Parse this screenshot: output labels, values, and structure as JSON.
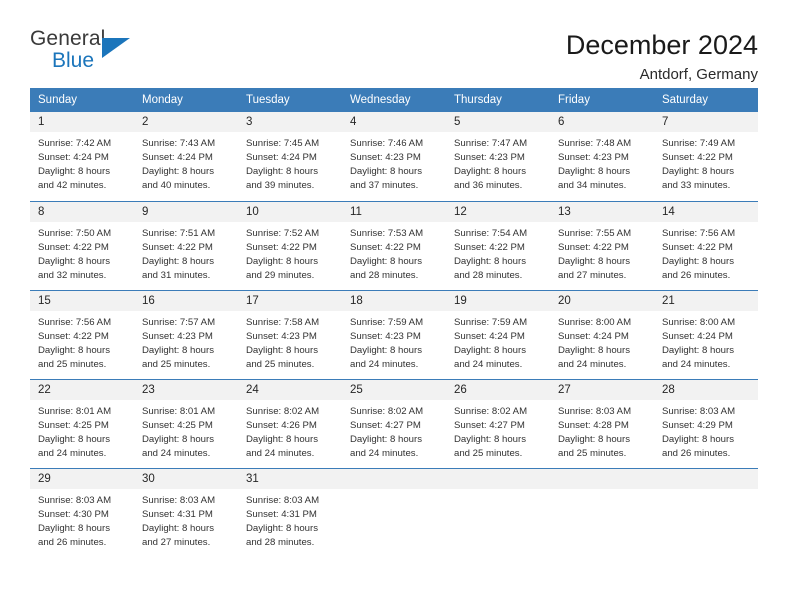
{
  "brand": {
    "name_part1": "General",
    "name_part2": "Blue",
    "accent_color": "#1b75bb",
    "triangle_icon": "triangle-icon"
  },
  "header": {
    "title": "December 2024",
    "subtitle": "Antdorf, Germany"
  },
  "calendar": {
    "header_bg": "#3b7cb8",
    "daynum_bg": "#f2f2f2",
    "weekdays": [
      "Sunday",
      "Monday",
      "Tuesday",
      "Wednesday",
      "Thursday",
      "Friday",
      "Saturday"
    ],
    "weeks": [
      [
        {
          "day": "1",
          "sunrise": "Sunrise: 7:42 AM",
          "sunset": "Sunset: 4:24 PM",
          "daylight1": "Daylight: 8 hours",
          "daylight2": "and 42 minutes."
        },
        {
          "day": "2",
          "sunrise": "Sunrise: 7:43 AM",
          "sunset": "Sunset: 4:24 PM",
          "daylight1": "Daylight: 8 hours",
          "daylight2": "and 40 minutes."
        },
        {
          "day": "3",
          "sunrise": "Sunrise: 7:45 AM",
          "sunset": "Sunset: 4:24 PM",
          "daylight1": "Daylight: 8 hours",
          "daylight2": "and 39 minutes."
        },
        {
          "day": "4",
          "sunrise": "Sunrise: 7:46 AM",
          "sunset": "Sunset: 4:23 PM",
          "daylight1": "Daylight: 8 hours",
          "daylight2": "and 37 minutes."
        },
        {
          "day": "5",
          "sunrise": "Sunrise: 7:47 AM",
          "sunset": "Sunset: 4:23 PM",
          "daylight1": "Daylight: 8 hours",
          "daylight2": "and 36 minutes."
        },
        {
          "day": "6",
          "sunrise": "Sunrise: 7:48 AM",
          "sunset": "Sunset: 4:23 PM",
          "daylight1": "Daylight: 8 hours",
          "daylight2": "and 34 minutes."
        },
        {
          "day": "7",
          "sunrise": "Sunrise: 7:49 AM",
          "sunset": "Sunset: 4:22 PM",
          "daylight1": "Daylight: 8 hours",
          "daylight2": "and 33 minutes."
        }
      ],
      [
        {
          "day": "8",
          "sunrise": "Sunrise: 7:50 AM",
          "sunset": "Sunset: 4:22 PM",
          "daylight1": "Daylight: 8 hours",
          "daylight2": "and 32 minutes."
        },
        {
          "day": "9",
          "sunrise": "Sunrise: 7:51 AM",
          "sunset": "Sunset: 4:22 PM",
          "daylight1": "Daylight: 8 hours",
          "daylight2": "and 31 minutes."
        },
        {
          "day": "10",
          "sunrise": "Sunrise: 7:52 AM",
          "sunset": "Sunset: 4:22 PM",
          "daylight1": "Daylight: 8 hours",
          "daylight2": "and 29 minutes."
        },
        {
          "day": "11",
          "sunrise": "Sunrise: 7:53 AM",
          "sunset": "Sunset: 4:22 PM",
          "daylight1": "Daylight: 8 hours",
          "daylight2": "and 28 minutes."
        },
        {
          "day": "12",
          "sunrise": "Sunrise: 7:54 AM",
          "sunset": "Sunset: 4:22 PM",
          "daylight1": "Daylight: 8 hours",
          "daylight2": "and 28 minutes."
        },
        {
          "day": "13",
          "sunrise": "Sunrise: 7:55 AM",
          "sunset": "Sunset: 4:22 PM",
          "daylight1": "Daylight: 8 hours",
          "daylight2": "and 27 minutes."
        },
        {
          "day": "14",
          "sunrise": "Sunrise: 7:56 AM",
          "sunset": "Sunset: 4:22 PM",
          "daylight1": "Daylight: 8 hours",
          "daylight2": "and 26 minutes."
        }
      ],
      [
        {
          "day": "15",
          "sunrise": "Sunrise: 7:56 AM",
          "sunset": "Sunset: 4:22 PM",
          "daylight1": "Daylight: 8 hours",
          "daylight2": "and 25 minutes."
        },
        {
          "day": "16",
          "sunrise": "Sunrise: 7:57 AM",
          "sunset": "Sunset: 4:23 PM",
          "daylight1": "Daylight: 8 hours",
          "daylight2": "and 25 minutes."
        },
        {
          "day": "17",
          "sunrise": "Sunrise: 7:58 AM",
          "sunset": "Sunset: 4:23 PM",
          "daylight1": "Daylight: 8 hours",
          "daylight2": "and 25 minutes."
        },
        {
          "day": "18",
          "sunrise": "Sunrise: 7:59 AM",
          "sunset": "Sunset: 4:23 PM",
          "daylight1": "Daylight: 8 hours",
          "daylight2": "and 24 minutes."
        },
        {
          "day": "19",
          "sunrise": "Sunrise: 7:59 AM",
          "sunset": "Sunset: 4:24 PM",
          "daylight1": "Daylight: 8 hours",
          "daylight2": "and 24 minutes."
        },
        {
          "day": "20",
          "sunrise": "Sunrise: 8:00 AM",
          "sunset": "Sunset: 4:24 PM",
          "daylight1": "Daylight: 8 hours",
          "daylight2": "and 24 minutes."
        },
        {
          "day": "21",
          "sunrise": "Sunrise: 8:00 AM",
          "sunset": "Sunset: 4:24 PM",
          "daylight1": "Daylight: 8 hours",
          "daylight2": "and 24 minutes."
        }
      ],
      [
        {
          "day": "22",
          "sunrise": "Sunrise: 8:01 AM",
          "sunset": "Sunset: 4:25 PM",
          "daylight1": "Daylight: 8 hours",
          "daylight2": "and 24 minutes."
        },
        {
          "day": "23",
          "sunrise": "Sunrise: 8:01 AM",
          "sunset": "Sunset: 4:25 PM",
          "daylight1": "Daylight: 8 hours",
          "daylight2": "and 24 minutes."
        },
        {
          "day": "24",
          "sunrise": "Sunrise: 8:02 AM",
          "sunset": "Sunset: 4:26 PM",
          "daylight1": "Daylight: 8 hours",
          "daylight2": "and 24 minutes."
        },
        {
          "day": "25",
          "sunrise": "Sunrise: 8:02 AM",
          "sunset": "Sunset: 4:27 PM",
          "daylight1": "Daylight: 8 hours",
          "daylight2": "and 24 minutes."
        },
        {
          "day": "26",
          "sunrise": "Sunrise: 8:02 AM",
          "sunset": "Sunset: 4:27 PM",
          "daylight1": "Daylight: 8 hours",
          "daylight2": "and 25 minutes."
        },
        {
          "day": "27",
          "sunrise": "Sunrise: 8:03 AM",
          "sunset": "Sunset: 4:28 PM",
          "daylight1": "Daylight: 8 hours",
          "daylight2": "and 25 minutes."
        },
        {
          "day": "28",
          "sunrise": "Sunrise: 8:03 AM",
          "sunset": "Sunset: 4:29 PM",
          "daylight1": "Daylight: 8 hours",
          "daylight2": "and 26 minutes."
        }
      ],
      [
        {
          "day": "29",
          "sunrise": "Sunrise: 8:03 AM",
          "sunset": "Sunset: 4:30 PM",
          "daylight1": "Daylight: 8 hours",
          "daylight2": "and 26 minutes."
        },
        {
          "day": "30",
          "sunrise": "Sunrise: 8:03 AM",
          "sunset": "Sunset: 4:31 PM",
          "daylight1": "Daylight: 8 hours",
          "daylight2": "and 27 minutes."
        },
        {
          "day": "31",
          "sunrise": "Sunrise: 8:03 AM",
          "sunset": "Sunset: 4:31 PM",
          "daylight1": "Daylight: 8 hours",
          "daylight2": "and 28 minutes."
        },
        {
          "day": "",
          "sunrise": "",
          "sunset": "",
          "daylight1": "",
          "daylight2": ""
        },
        {
          "day": "",
          "sunrise": "",
          "sunset": "",
          "daylight1": "",
          "daylight2": ""
        },
        {
          "day": "",
          "sunrise": "",
          "sunset": "",
          "daylight1": "",
          "daylight2": ""
        },
        {
          "day": "",
          "sunrise": "",
          "sunset": "",
          "daylight1": "",
          "daylight2": ""
        }
      ]
    ]
  }
}
